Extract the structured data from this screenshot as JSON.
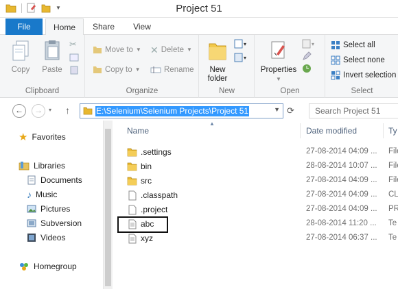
{
  "window": {
    "title": "Project 51"
  },
  "tabs": {
    "file": "File",
    "home": "Home",
    "share": "Share",
    "view": "View"
  },
  "ribbon": {
    "clipboard": {
      "label": "Clipboard",
      "copy": "Copy",
      "paste": "Paste"
    },
    "organize": {
      "label": "Organize",
      "move_to": "Move to",
      "copy_to": "Copy to",
      "delete": "Delete",
      "rename": "Rename"
    },
    "new": {
      "label": "New",
      "new_folder_line1": "New",
      "new_folder_line2": "folder"
    },
    "open": {
      "label": "Open",
      "properties": "Properties"
    },
    "select": {
      "label": "Select",
      "select_all": "Select all",
      "select_none": "Select none",
      "invert_selection": "Invert selection"
    }
  },
  "address": {
    "path": "E:\\Selenium\\Selenium Projects\\Project 51",
    "search_placeholder": "Search Project 51"
  },
  "nav_pane": {
    "favorites": "Favorites",
    "libraries": "Libraries",
    "library_items": [
      "Documents",
      "Music",
      "Pictures",
      "Subversion",
      "Videos"
    ],
    "homegroup": "Homegroup"
  },
  "file_list": {
    "columns": {
      "name": "Name",
      "date_modified": "Date modified",
      "type": "Ty"
    },
    "rows": [
      {
        "name": ".settings",
        "date": "27-08-2014 04:09 ...",
        "type": "File",
        "icon": "folder-icon"
      },
      {
        "name": "bin",
        "date": "28-08-2014 10:07 ...",
        "type": "File",
        "icon": "folder-icon"
      },
      {
        "name": "src",
        "date": "27-08-2014 04:09 ...",
        "type": "File",
        "icon": "folder-icon"
      },
      {
        "name": ".classpath",
        "date": "27-08-2014 04:09 ...",
        "type": "CL",
        "icon": "file-icon"
      },
      {
        "name": ".project",
        "date": "27-08-2014 04:09 ...",
        "type": "PR",
        "icon": "file-icon"
      },
      {
        "name": "abc",
        "date": "28-08-2014 11:20 ...",
        "type": "Te",
        "icon": "text-file-icon"
      },
      {
        "name": "xyz",
        "date": "27-08-2014 06:37 ...",
        "type": "Te",
        "icon": "text-file-icon"
      }
    ]
  },
  "colors": {
    "accent": "#1979ca",
    "selection": "#3399ff",
    "folder": "#e8b830"
  }
}
